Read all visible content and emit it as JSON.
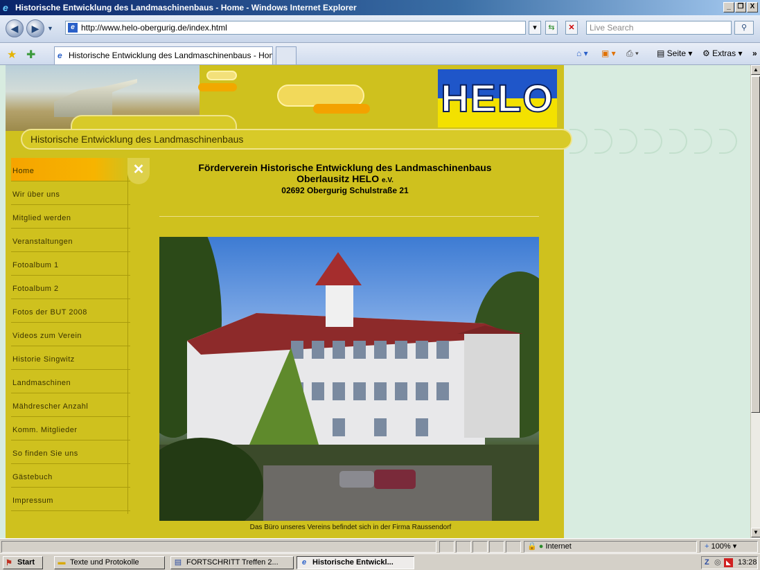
{
  "window": {
    "title": "Historische Entwicklung des Landmaschinenbaus - Home - Windows Internet Explorer",
    "min": "_",
    "max": "❐",
    "close": "X"
  },
  "address": {
    "url": "http://www.helo-obergurig.de/index.html",
    "search_placeholder": "Live Search"
  },
  "tabs": {
    "active": "Historische Entwicklung des Landmaschinenbaus - Home"
  },
  "commands": {
    "seite": "Seite",
    "extras": "Extras"
  },
  "site": {
    "logo": "HELO",
    "band_title": "Historische Entwicklung des Landmaschinenbaus",
    "heading_line1": "Förderverein Historische Entwicklung des Landmaschinenbaus",
    "heading_line2": "Oberlausitz HELO",
    "heading_ev": "e.V.",
    "heading_line3": "02692 Obergurig Schulstraße 21",
    "photo_caption": "Das Büro unseres Vereins befindet sich in der Firma Raussendorf",
    "nav": [
      "Home",
      "Wir über uns",
      "Mitglied werden",
      "Veranstaltungen",
      "Fotoalbum 1",
      "Fotoalbum 2",
      "Fotos der BUT 2008",
      "Videos zum Verein",
      "Historie Singwitz",
      "Landmaschinen",
      "Mähdrescher Anzahl",
      "Komm. Mitglieder",
      "So finden Sie uns",
      "Gästebuch",
      "Impressum"
    ]
  },
  "status": {
    "zone": "Internet",
    "zoom": "100%"
  },
  "taskbar": {
    "start": "Start",
    "items": [
      "Texte und Protokolle",
      "FORTSCHRITT Treffen 2...",
      "Historische Entwickl..."
    ],
    "clock": "13:28"
  },
  "colors": {
    "site_bg": "#cfc11e",
    "nav_active": "#f6a400",
    "logo_blue": "#1f56c9",
    "logo_yellow": "#f3e100",
    "page_side": "#d8ece0"
  }
}
